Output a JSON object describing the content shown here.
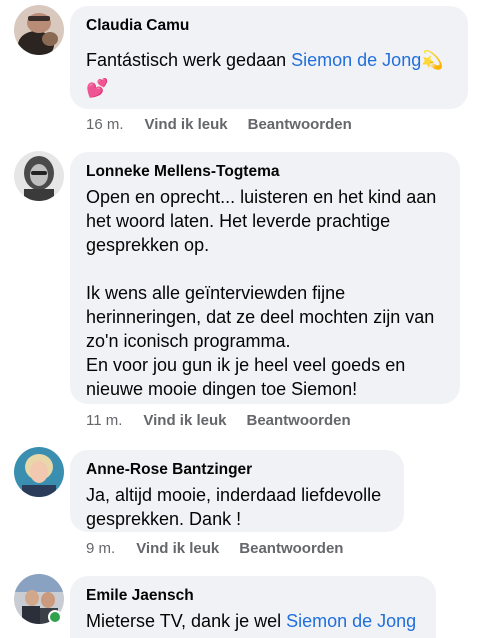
{
  "comments": [
    {
      "author": "Claudia Camu",
      "text_before": "Fantástisch werk gedaan ",
      "mention": "Siemon de Jong",
      "emoji_line1": "💫",
      "emoji_line2": "💕",
      "time": "16 m.",
      "like": "Vind ik leuk",
      "reply": "Beantwoorden"
    },
    {
      "author": "Lonneke Mellens-Togtema",
      "lines_p1": [
        "Open en oprecht... luisteren en het kind aan",
        "het woord laten. Het leverde prachtige",
        "gesprekken op."
      ],
      "lines_p2": [
        "Ik wens alle geïnterviewden fijne",
        "herinneringen, dat ze deel mochten zijn van",
        "zo'n iconisch programma.",
        "En voor jou gun ik je heel veel goeds en",
        "nieuwe mooie dingen toe Siemon!"
      ],
      "time": "11 m.",
      "like": "Vind ik leuk",
      "reply": "Beantwoorden"
    },
    {
      "author": "Anne-Rose Bantzinger",
      "lines": [
        "Ja, altijd mooie, inderdaad liefdevolle",
        "gesprekken. Dank !"
      ],
      "time": "9 m.",
      "like": "Vind ik leuk",
      "reply": "Beantwoorden"
    },
    {
      "author": "Emile Jaensch",
      "text_before": "Mieterse TV, dank je wel ",
      "mention": "Siemon de Jong"
    }
  ],
  "colors": {
    "bubble": "#f0f2f5",
    "mention": "#216fdb",
    "meta": "#65676b",
    "online": "#31a24c"
  }
}
